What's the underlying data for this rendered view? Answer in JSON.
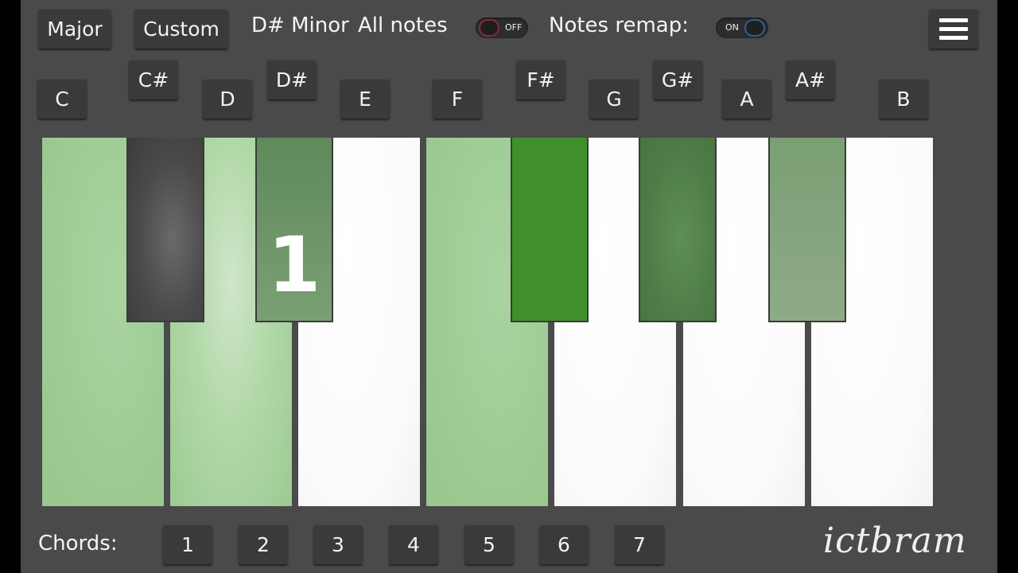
{
  "toolbar": {
    "major_label": "Major",
    "custom_label": "Custom",
    "scale_name": "D# Minor",
    "all_notes_label": "All notes",
    "all_notes_toggle": "OFF",
    "remap_label": "Notes remap:",
    "remap_toggle": "ON",
    "menu_icon": "hamburger-menu-icon"
  },
  "note_buttons": [
    "C",
    "C#",
    "D",
    "D#",
    "E",
    "F",
    "F#",
    "G",
    "G#",
    "A",
    "A#",
    "B"
  ],
  "keyboard": {
    "white_keys": [
      {
        "note": "C",
        "state": "highlighted",
        "color": "#9cca92"
      },
      {
        "note": "D",
        "state": "highlighted",
        "color": "#b2d8a8"
      },
      {
        "note": "E",
        "state": "normal",
        "color": "#ffffff"
      },
      {
        "note": "F",
        "state": "highlighted",
        "color": "#9cca92"
      },
      {
        "note": "G",
        "state": "normal",
        "color": "#ffffff"
      },
      {
        "note": "A",
        "state": "normal",
        "color": "#ffffff"
      },
      {
        "note": "B",
        "state": "normal",
        "color": "#ffffff"
      }
    ],
    "black_keys": [
      {
        "note": "C#",
        "state": "normal",
        "color": "#4a4a4a"
      },
      {
        "note": "D#",
        "state": "highlighted",
        "color": "#6a9464",
        "label": "1"
      },
      {
        "note": "F#",
        "state": "active",
        "color": "#3f8f2c"
      },
      {
        "note": "G#",
        "state": "highlighted",
        "color": "#4e7c47"
      },
      {
        "note": "A#",
        "state": "highlighted",
        "color": "#85a37f"
      }
    ]
  },
  "chords": {
    "label": "Chords:",
    "buttons": [
      "1",
      "2",
      "3",
      "4",
      "5",
      "6",
      "7"
    ]
  },
  "watermark": "ictbram"
}
